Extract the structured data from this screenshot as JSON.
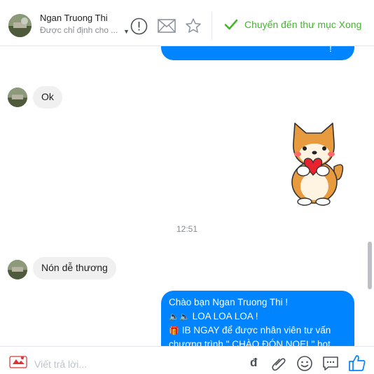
{
  "header": {
    "contact_name": "Ngan Truong Thi",
    "assign_text": "Được chỉ định cho ...",
    "done_label": "Chuyển đến thư mục Xong",
    "colors": {
      "done": "#42b72a",
      "icon": "#8d949e"
    }
  },
  "conversation": {
    "top_partial_text": "!",
    "messages": [
      {
        "direction": "incoming",
        "text": "Ok"
      },
      {
        "direction": "outgoing",
        "type": "sticker",
        "sticker": "shiba-dog-holding-heart"
      },
      {
        "direction": "incoming",
        "text": "Nón dễ thương"
      }
    ],
    "timestamp": "12:51",
    "long_message": {
      "line1": "Chào bạn Ngan Truong Thi !",
      "line2": "LOA LOA LOA !",
      "line3": "IB NGAY để được nhân viên tư vấn",
      "line4": "chương trình \" CHÀO ĐÓN NOEL\" hot"
    },
    "colors": {
      "outgoing": "#0084ff",
      "incoming": "#f1f0f0"
    }
  },
  "composer": {
    "placeholder": "Viết trả lời...",
    "currency_symbol": "đ",
    "icons": [
      "paperclip-icon",
      "smile-icon",
      "saved-reply-icon",
      "thumbs-up-icon"
    ]
  }
}
